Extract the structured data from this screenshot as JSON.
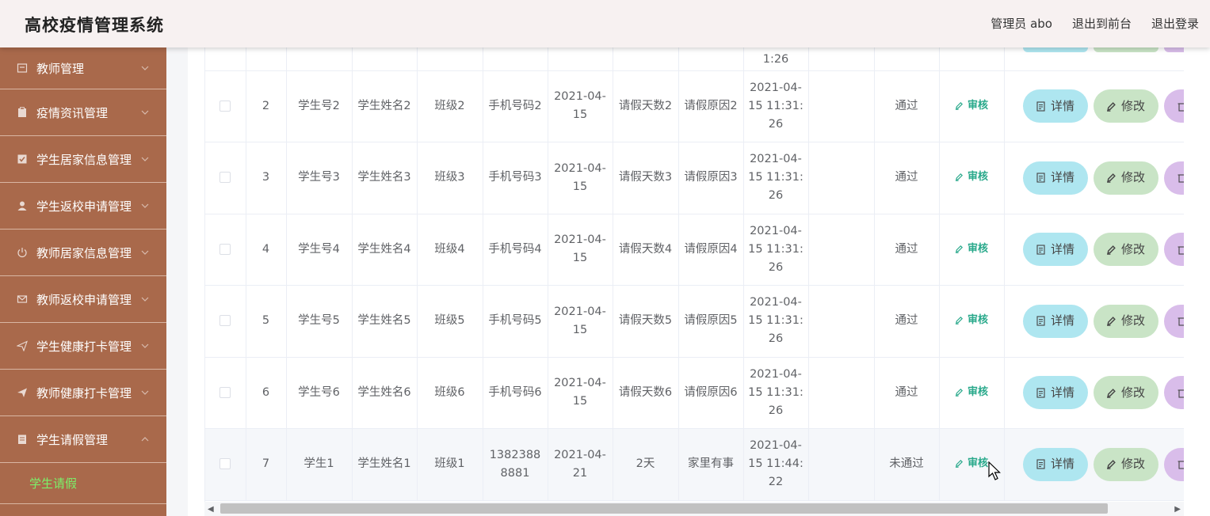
{
  "header": {
    "title": "高校疫情管理系统",
    "nav": [
      "管理员 abo",
      "退出到前台",
      "退出登录"
    ]
  },
  "sidebar": {
    "items": [
      {
        "label": "教师管理",
        "icon": "document-icon"
      },
      {
        "label": "疫情资讯管理",
        "icon": "clipboard-icon"
      },
      {
        "label": "学生居家信息管理",
        "icon": "checkbox-icon"
      },
      {
        "label": "学生返校申请管理",
        "icon": "user-icon"
      },
      {
        "label": "教师居家信息管理",
        "icon": "power-icon"
      },
      {
        "label": "教师返校申请管理",
        "icon": "mail-icon"
      },
      {
        "label": "学生健康打卡管理",
        "icon": "send-icon"
      },
      {
        "label": "教师健康打卡管理",
        "icon": "paper-plane-icon"
      },
      {
        "label": "学生请假管理",
        "icon": "notebook-icon"
      }
    ],
    "active_sub": "学生请假"
  },
  "table": {
    "partial_row_time": "1:26",
    "rows": [
      {
        "idx": "2",
        "sid": "学生号2",
        "name": "学生姓名2",
        "cls": "班级2",
        "phone": "手机号码2",
        "date": "2021-04-15",
        "days": "请假天数2",
        "reason": "请假原因2",
        "time": "2021-04-15 11:31:26",
        "status": "通过"
      },
      {
        "idx": "3",
        "sid": "学生号3",
        "name": "学生姓名3",
        "cls": "班级3",
        "phone": "手机号码3",
        "date": "2021-04-15",
        "days": "请假天数3",
        "reason": "请假原因3",
        "time": "2021-04-15 11:31:26",
        "status": "通过"
      },
      {
        "idx": "4",
        "sid": "学生号4",
        "name": "学生姓名4",
        "cls": "班级4",
        "phone": "手机号码4",
        "date": "2021-04-15",
        "days": "请假天数4",
        "reason": "请假原因4",
        "time": "2021-04-15 11:31:26",
        "status": "通过"
      },
      {
        "idx": "5",
        "sid": "学生号5",
        "name": "学生姓名5",
        "cls": "班级5",
        "phone": "手机号码5",
        "date": "2021-04-15",
        "days": "请假天数5",
        "reason": "请假原因5",
        "time": "2021-04-15 11:31:26",
        "status": "通过"
      },
      {
        "idx": "6",
        "sid": "学生号6",
        "name": "学生姓名6",
        "cls": "班级6",
        "phone": "手机号码6",
        "date": "2021-04-15",
        "days": "请假天数6",
        "reason": "请假原因6",
        "time": "2021-04-15 11:31:26",
        "status": "通过"
      },
      {
        "idx": "7",
        "sid": "学生1",
        "name": "学生姓名1",
        "cls": "班级1",
        "phone": "13823888881",
        "date": "2021-04-21",
        "days": "2天",
        "reason": "家里有事",
        "time": "2021-04-15 11:44:22",
        "status": "未通过"
      }
    ],
    "audit_label": "审核",
    "detail_label": "详情",
    "edit_label": "修改"
  },
  "colors": {
    "sidebar_bg": "#a9694b",
    "active_sub": "#7cf06a",
    "audit": "#29a98b",
    "detail_btn": "#aee6f0",
    "edit_btn": "#c9e4c6",
    "delete_btn": "#d9bdea"
  }
}
